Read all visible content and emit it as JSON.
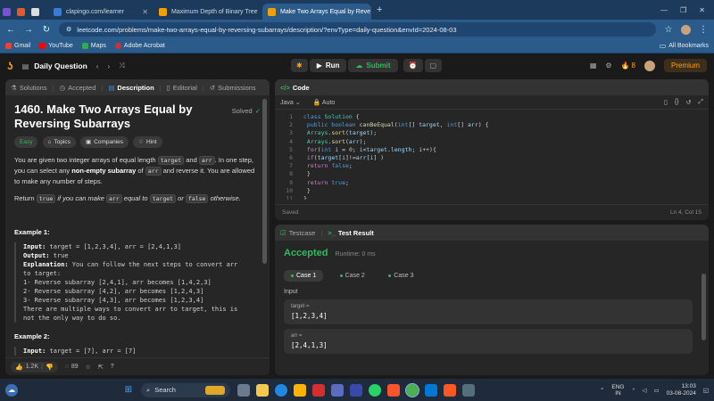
{
  "browser": {
    "tabs": [
      {
        "label": "",
        "color": "#7b4fd6",
        "active": false
      },
      {
        "label": "",
        "color": "#e05a2b",
        "active": false
      },
      {
        "label": "",
        "color": "#ddd",
        "active": false
      },
      {
        "label": "clapingo.com/learner",
        "color": "#3a7bd5",
        "active": false
      },
      {
        "label": "Maximum Depth of Binary Tree",
        "color": "#f59f00",
        "active": false
      },
      {
        "label": "Make Two Arrays Equal by Reve",
        "color": "#f59f00",
        "active": true
      }
    ],
    "url": "leetcode.com/problems/make-two-arrays-equal-by-reversing-subarrays/description/?envType=daily-question&envId=2024-08-03",
    "bookmarks": [
      {
        "label": "Gmail",
        "color": "#ea4335"
      },
      {
        "label": "YouTube",
        "color": "#ff0000"
      },
      {
        "label": "Maps",
        "color": "#34a853"
      },
      {
        "label": "Adobe Acrobat",
        "color": "#d32f2f"
      }
    ],
    "all_bookmarks": "All Bookmarks"
  },
  "lc_nav": {
    "daily_question": "Daily Question",
    "run": "Run",
    "submit": "Submit",
    "streak": "8",
    "premium": "Premium"
  },
  "left_panel": {
    "tabs": [
      "Solutions",
      "Accepted",
      "Description",
      "Editorial",
      "Submissions"
    ],
    "title_line1": "1460. Make Two Arrays Equal by",
    "title_line2": "Reversing Subarrays",
    "solved": "Solved",
    "chips": [
      "Easy",
      "Topics",
      "Companies",
      "Hint"
    ],
    "p1_a": "You are given two integer arrays of equal length ",
    "p1_code1": "target",
    "p1_b": " and ",
    "p1_code2": "arr",
    "p1_c": ". In one step, you can select any ",
    "p1_bold": "non-empty subarray",
    "p1_d": " of ",
    "p1_code3": "arr",
    "p1_e": " and reverse it. You are allowed to make any number of steps.",
    "p2_a": "Return ",
    "p2_code1": "true",
    "p2_b": " if you can make ",
    "p2_code2": "arr",
    "p2_c": " equal to ",
    "p2_code3": "target",
    "p2_d": " or ",
    "p2_code4": "false",
    "p2_e": " otherwise.",
    "example1_label": "Example 1:",
    "ex1_input_label": "Input:",
    "ex1_input": " target = [1,2,3,4], arr = [2,4,1,3]",
    "ex1_output_label": "Output:",
    "ex1_output": " true",
    "ex1_expl_label": "Explanation:",
    "ex1_expl_lines": [
      " You can follow the next steps to convert arr",
      "to target:",
      "1- Reverse subarray [2,4,1], arr becomes [1,4,2,3]",
      "2- Reverse subarray [4,2], arr becomes [1,2,4,3]",
      "3- Reverse subarray [4,3], arr becomes [1,2,3,4]",
      "There are multiple ways to convert arr to target, this is",
      "not the only way to do so."
    ],
    "example2_label": "Example 2:",
    "ex2_input_label": "Input:",
    "ex2_input": " target = [7], arr = [7]",
    "likes": "1.2K",
    "comments": "89"
  },
  "code_panel": {
    "title": "Code",
    "language": "Java",
    "auto": "Auto",
    "saved": "Saved",
    "cursor": "Ln 4, Col 15",
    "line_numbers": [
      "1",
      "2",
      "3",
      "4",
      "5",
      "6",
      "7",
      "8",
      "9",
      "10",
      "11"
    ]
  },
  "test_panel": {
    "tab_testcase": "Testcase",
    "tab_result": "Test Result",
    "accepted": "Accepted",
    "runtime": "Runtime: 0 ms",
    "cases": [
      "Case 1",
      "Case 2",
      "Case 3"
    ],
    "input_label": "Input",
    "var1_name": "target =",
    "var1_value": "[1,2,3,4]",
    "var2_name": "arr =",
    "var2_value": "[2,4,1,3]"
  },
  "taskbar": {
    "search": "Search",
    "lang_line1": "ENG",
    "lang_line2": "IN",
    "time": "13:03",
    "date": "03-08-2024"
  },
  "colors": {
    "accent_green": "#2cbb5d",
    "premium": "#ffa116",
    "tab_blue": "#2b5b8a"
  }
}
